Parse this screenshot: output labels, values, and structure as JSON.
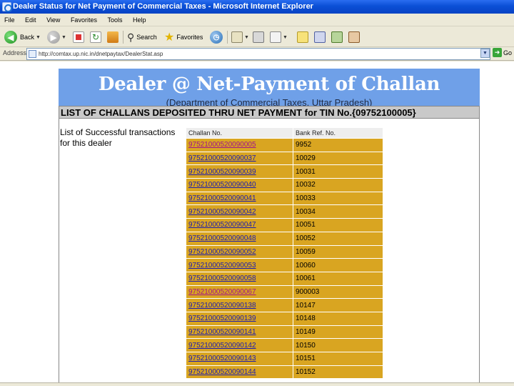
{
  "window": {
    "title": "Dealer Status for Net Payment of Commercial Taxes - Microsoft Internet Explorer"
  },
  "menu": [
    "File",
    "Edit",
    "View",
    "Favorites",
    "Tools",
    "Help"
  ],
  "toolbar": {
    "back_label": "Back",
    "search_label": "Search",
    "favorites_label": "Favorites"
  },
  "address": {
    "label": "Address",
    "url": "http://comtax.up.nic.in/dnetpaytax/DealerStat.asp",
    "go_label": "Go"
  },
  "page": {
    "banner_title": "Dealer @ Net-Payment of Challan",
    "banner_subtitle": "(Department of Commercial Taxes, Uttar Pradesh)",
    "list_heading": "LIST OF CHALLANS DEPOSITED THRU NET PAYMENT for TIN No.{09752100005}",
    "sidebar_text": "List of Successful transactions for this dealer",
    "table": {
      "headers": [
        "Challan No.",
        "Bank Ref. No."
      ],
      "rows": [
        {
          "challan": "97521000520090005",
          "ref": "9952",
          "visited": true
        },
        {
          "challan": "97521000520090037",
          "ref": "10029",
          "visited": false
        },
        {
          "challan": "97521000520090039",
          "ref": "10031",
          "visited": false
        },
        {
          "challan": "97521000520090040",
          "ref": "10032",
          "visited": false
        },
        {
          "challan": "97521000520090041",
          "ref": "10033",
          "visited": false
        },
        {
          "challan": "97521000520090042",
          "ref": "10034",
          "visited": false
        },
        {
          "challan": "97521000520090047",
          "ref": "10051",
          "visited": false
        },
        {
          "challan": "97521000520090048",
          "ref": "10052",
          "visited": false
        },
        {
          "challan": "97521000520090052",
          "ref": "10059",
          "visited": false
        },
        {
          "challan": "97521000520090053",
          "ref": "10060",
          "visited": false
        },
        {
          "challan": "97521000520090058",
          "ref": "10061",
          "visited": false
        },
        {
          "challan": "97521000520090067",
          "ref": "900003",
          "visited": true
        },
        {
          "challan": "97521000520090138",
          "ref": "10147",
          "visited": false
        },
        {
          "challan": "97521000520090139",
          "ref": "10148",
          "visited": false
        },
        {
          "challan": "97521000520090141",
          "ref": "10149",
          "visited": false
        },
        {
          "challan": "97521000520090142",
          "ref": "10150",
          "visited": false
        },
        {
          "challan": "97521000520090143",
          "ref": "10151",
          "visited": false
        },
        {
          "challan": "97521000520090144",
          "ref": "10152",
          "visited": false
        }
      ]
    }
  },
  "colors": {
    "banner": "#6fa0e8",
    "row_bg": "#d9a521",
    "link": "#1d1db0",
    "visited_link": "#a0148c"
  }
}
